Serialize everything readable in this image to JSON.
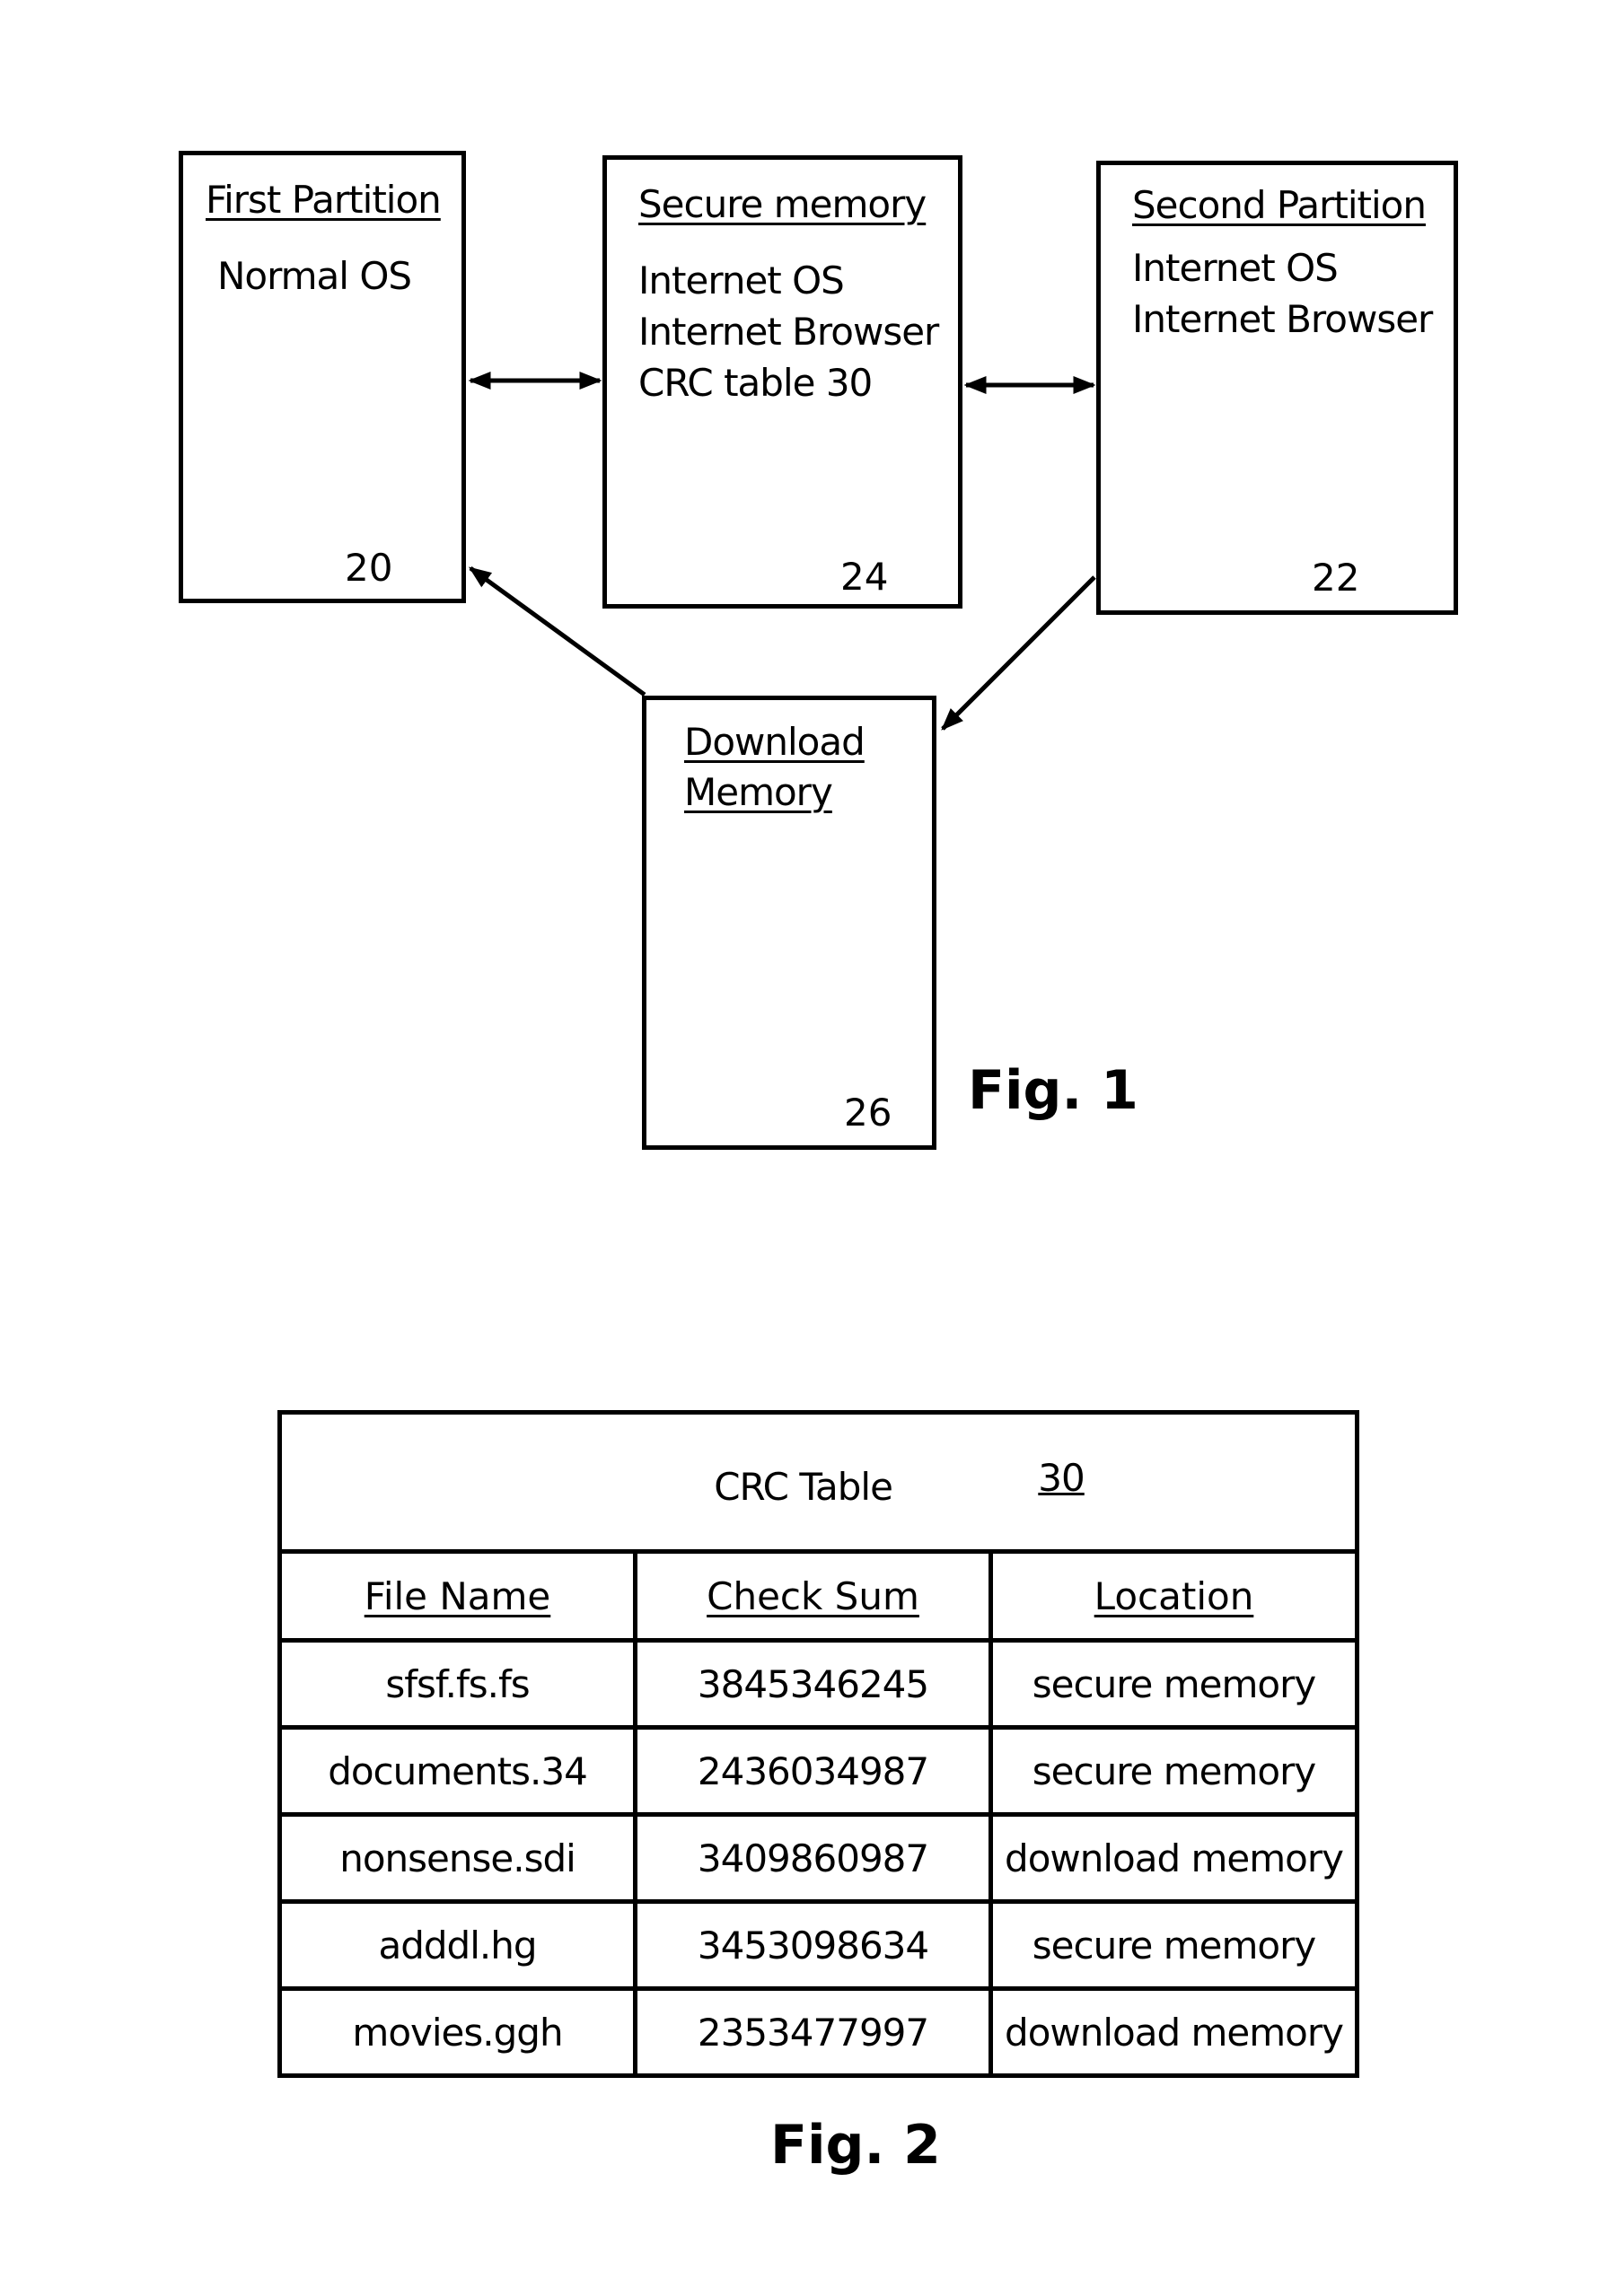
{
  "figure1": {
    "caption": "Fig. 1",
    "boxes": {
      "first_partition": {
        "title": "First Partition",
        "lines": [
          "Normal OS"
        ],
        "ref": "20"
      },
      "secure_memory": {
        "title": "Secure memory",
        "lines": [
          "Internet OS",
          "Internet Browser",
          "CRC table 30"
        ],
        "ref": "24"
      },
      "second_partition": {
        "title": "Second Partition",
        "lines": [
          "Internet OS",
          "Internet Browser"
        ],
        "ref": "22"
      },
      "download_memory": {
        "title_lines": [
          "Download",
          "Memory"
        ],
        "ref": "26"
      }
    },
    "connections": [
      {
        "from": "first_partition",
        "to": "secure_memory",
        "type": "bidirectional"
      },
      {
        "from": "secure_memory",
        "to": "second_partition",
        "type": "bidirectional"
      },
      {
        "from": "second_partition",
        "to": "download_memory",
        "type": "directed"
      },
      {
        "from": "download_memory",
        "to": "first_partition",
        "type": "directed"
      }
    ]
  },
  "figure2": {
    "caption": "Fig. 2",
    "table_title": "CRC Table",
    "table_ref": "30",
    "columns": [
      "File Name",
      "Check Sum",
      "Location"
    ],
    "rows": [
      [
        "sfsf.fs.fs",
        "3845346245",
        "secure memory"
      ],
      [
        "documents.34",
        "2436034987",
        "secure memory"
      ],
      [
        "nonsense.sdi",
        "3409860987",
        "download memory"
      ],
      [
        "adddl.hg",
        "3453098634",
        "secure memory"
      ],
      [
        "movies.ggh",
        "2353477997",
        "download memory"
      ]
    ]
  }
}
